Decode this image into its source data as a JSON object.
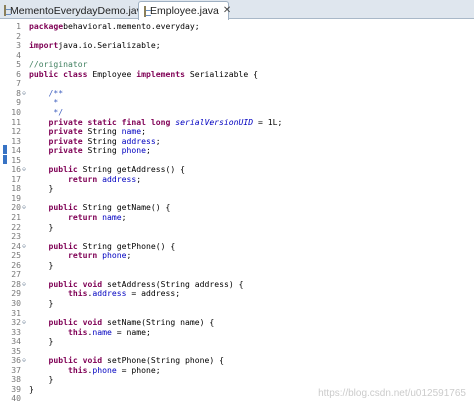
{
  "tabs": [
    {
      "label": "MementoEverydayDemo.java",
      "active": false
    },
    {
      "label": "Employee.java",
      "active": true,
      "close": "✕"
    }
  ],
  "watermark": "https://blog.csdn.net/u012591765",
  "colors": {
    "keyword": "#7f0055",
    "field": "#0000c0",
    "comment": "#3f7f5f",
    "javadoc": "#3f5fbf"
  },
  "lines": [
    {
      "n": "1",
      "t": [
        [
          "kw",
          "package"
        ],
        [
          "",
          "behavioral.memento.everyday;"
        ]
      ]
    },
    {
      "n": "2",
      "t": []
    },
    {
      "n": "3",
      "t": [
        [
          "kw",
          "import"
        ],
        [
          "",
          "java.io.Serializable;"
        ]
      ]
    },
    {
      "n": "4",
      "t": []
    },
    {
      "n": "5",
      "t": [
        [
          "cmt",
          "//originator"
        ]
      ]
    },
    {
      "n": "6",
      "t": [
        [
          "kw",
          "public class"
        ],
        [
          "",
          " Employee "
        ],
        [
          "kw",
          "implements"
        ],
        [
          "",
          " Serializable {"
        ]
      ]
    },
    {
      "n": "7",
      "t": []
    },
    {
      "n": "8",
      "fold": true,
      "t": [
        [
          "",
          "    "
        ],
        [
          "jd",
          "/**"
        ]
      ]
    },
    {
      "n": "9",
      "t": [
        [
          "",
          "     "
        ],
        [
          "jd",
          "*"
        ]
      ]
    },
    {
      "n": "10",
      "t": [
        [
          "",
          "     "
        ],
        [
          "jd",
          "*/"
        ]
      ]
    },
    {
      "n": "11",
      "t": [
        [
          "",
          "    "
        ],
        [
          "kw",
          "private static final long"
        ],
        [
          "",
          " "
        ],
        [
          "it",
          "serialVersionUID"
        ],
        [
          "",
          " = 1L;"
        ]
      ]
    },
    {
      "n": "12",
      "t": [
        [
          "",
          "    "
        ],
        [
          "kw",
          "private"
        ],
        [
          "",
          " String "
        ],
        [
          "fld",
          "name"
        ],
        [
          "",
          ";"
        ]
      ]
    },
    {
      "n": "13",
      "t": [
        [
          "",
          "    "
        ],
        [
          "kw",
          "private"
        ],
        [
          "",
          " String "
        ],
        [
          "fld",
          "address"
        ],
        [
          "",
          ";"
        ]
      ]
    },
    {
      "n": "14",
      "t": [
        [
          "",
          "    "
        ],
        [
          "kw",
          "private"
        ],
        [
          "",
          " String "
        ],
        [
          "fld",
          "phone"
        ],
        [
          "",
          ";"
        ]
      ]
    },
    {
      "n": "15",
      "t": []
    },
    {
      "n": "16",
      "fold": true,
      "t": [
        [
          "",
          "    "
        ],
        [
          "kw",
          "public"
        ],
        [
          "",
          " String getAddress() {"
        ]
      ]
    },
    {
      "n": "17",
      "t": [
        [
          "",
          "        "
        ],
        [
          "kw",
          "return"
        ],
        [
          "",
          " "
        ],
        [
          "fld",
          "address"
        ],
        [
          "",
          ";"
        ]
      ]
    },
    {
      "n": "18",
      "t": [
        [
          "",
          "    }"
        ]
      ]
    },
    {
      "n": "19",
      "t": []
    },
    {
      "n": "20",
      "fold": true,
      "t": [
        [
          "",
          "    "
        ],
        [
          "kw",
          "public"
        ],
        [
          "",
          " String getName() {"
        ]
      ]
    },
    {
      "n": "21",
      "t": [
        [
          "",
          "        "
        ],
        [
          "kw",
          "return"
        ],
        [
          "",
          " "
        ],
        [
          "fld",
          "name"
        ],
        [
          "",
          ";"
        ]
      ]
    },
    {
      "n": "22",
      "t": [
        [
          "",
          "    }"
        ]
      ]
    },
    {
      "n": "23",
      "t": []
    },
    {
      "n": "24",
      "fold": true,
      "t": [
        [
          "",
          "    "
        ],
        [
          "kw",
          "public"
        ],
        [
          "",
          " String getPhone() {"
        ]
      ]
    },
    {
      "n": "25",
      "t": [
        [
          "",
          "        "
        ],
        [
          "kw",
          "return"
        ],
        [
          "",
          " "
        ],
        [
          "fld",
          "phone"
        ],
        [
          "",
          ";"
        ]
      ]
    },
    {
      "n": "26",
      "t": [
        [
          "",
          "    }"
        ]
      ]
    },
    {
      "n": "27",
      "t": []
    },
    {
      "n": "28",
      "fold": true,
      "t": [
        [
          "",
          "    "
        ],
        [
          "kw",
          "public void"
        ],
        [
          "",
          " setAddress(String "
        ],
        [
          "",
          "address"
        ],
        [
          "",
          ") {"
        ]
      ]
    },
    {
      "n": "29",
      "t": [
        [
          "",
          "        "
        ],
        [
          "kw",
          "this"
        ],
        [
          "",
          "."
        ],
        [
          "fld",
          "address"
        ],
        [
          "",
          " = address;"
        ]
      ]
    },
    {
      "n": "30",
      "t": [
        [
          "",
          "    }"
        ]
      ]
    },
    {
      "n": "31",
      "t": []
    },
    {
      "n": "32",
      "fold": true,
      "t": [
        [
          "",
          "    "
        ],
        [
          "kw",
          "public void"
        ],
        [
          "",
          " setName(String "
        ],
        [
          "",
          "name"
        ],
        [
          "",
          ") {"
        ]
      ]
    },
    {
      "n": "33",
      "t": [
        [
          "",
          "        "
        ],
        [
          "kw",
          "this"
        ],
        [
          "",
          "."
        ],
        [
          "fld",
          "name"
        ],
        [
          "",
          " = name;"
        ]
      ]
    },
    {
      "n": "34",
      "t": [
        [
          "",
          "    }"
        ]
      ]
    },
    {
      "n": "35",
      "t": []
    },
    {
      "n": "36",
      "fold": true,
      "t": [
        [
          "",
          "    "
        ],
        [
          "kw",
          "public void"
        ],
        [
          "",
          " setPhone(String "
        ],
        [
          "",
          "phone"
        ],
        [
          "",
          ") {"
        ]
      ]
    },
    {
      "n": "37",
      "t": [
        [
          "",
          "        "
        ],
        [
          "kw",
          "this"
        ],
        [
          "",
          "."
        ],
        [
          "fld",
          "phone"
        ],
        [
          "",
          " = phone;"
        ]
      ]
    },
    {
      "n": "38",
      "t": [
        [
          "",
          "    }"
        ]
      ]
    },
    {
      "n": "39",
      "t": [
        [
          "",
          "}"
        ]
      ]
    },
    {
      "n": "40",
      "t": []
    }
  ]
}
